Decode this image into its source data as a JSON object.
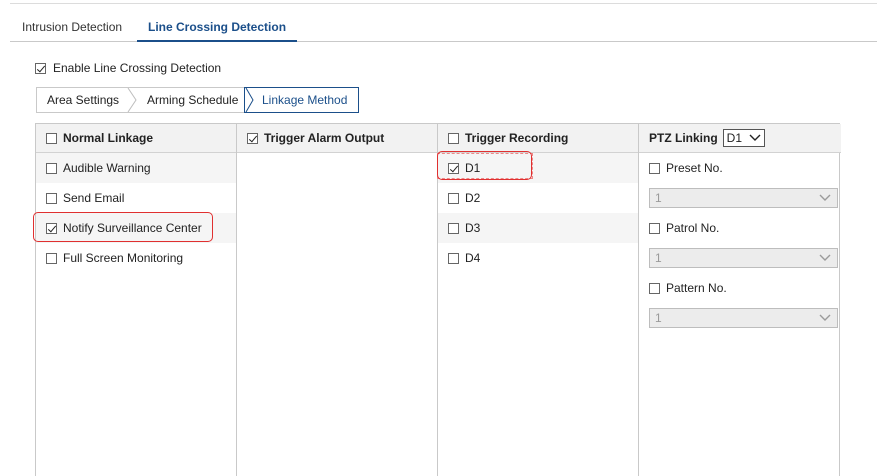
{
  "tabs": [
    {
      "label": "Intrusion Detection",
      "active": false
    },
    {
      "label": "Line Crossing Detection",
      "active": true
    }
  ],
  "enable": {
    "label": "Enable Line Crossing Detection",
    "checked": true
  },
  "subtabs": [
    {
      "label": "Area Settings",
      "active": false
    },
    {
      "label": "Arming Schedule",
      "active": false
    },
    {
      "label": "Linkage Method",
      "active": true
    }
  ],
  "normal_linkage": {
    "header": "Normal Linkage",
    "checked": false,
    "items": [
      {
        "label": "Audible Warning",
        "checked": false
      },
      {
        "label": "Send Email",
        "checked": false
      },
      {
        "label": "Notify Surveillance Center",
        "checked": true
      },
      {
        "label": "Full Screen Monitoring",
        "checked": false
      }
    ]
  },
  "trigger_alarm": {
    "header": "Trigger Alarm Output",
    "checked": true
  },
  "trigger_recording": {
    "header": "Trigger Recording",
    "checked": false,
    "items": [
      {
        "label": "D1",
        "checked": true
      },
      {
        "label": "D2",
        "checked": false
      },
      {
        "label": "D3",
        "checked": false
      },
      {
        "label": "D4",
        "checked": false
      }
    ]
  },
  "ptz": {
    "header": "PTZ Linking",
    "channel": "D1",
    "preset": {
      "label": "Preset No.",
      "checked": false,
      "value": "1"
    },
    "patrol": {
      "label": "Patrol No.",
      "checked": false,
      "value": "1"
    },
    "pattern": {
      "label": "Pattern No.",
      "checked": false,
      "value": "1"
    }
  },
  "colors": {
    "accent": "#1b4f8a",
    "highlight": "#e03030"
  }
}
